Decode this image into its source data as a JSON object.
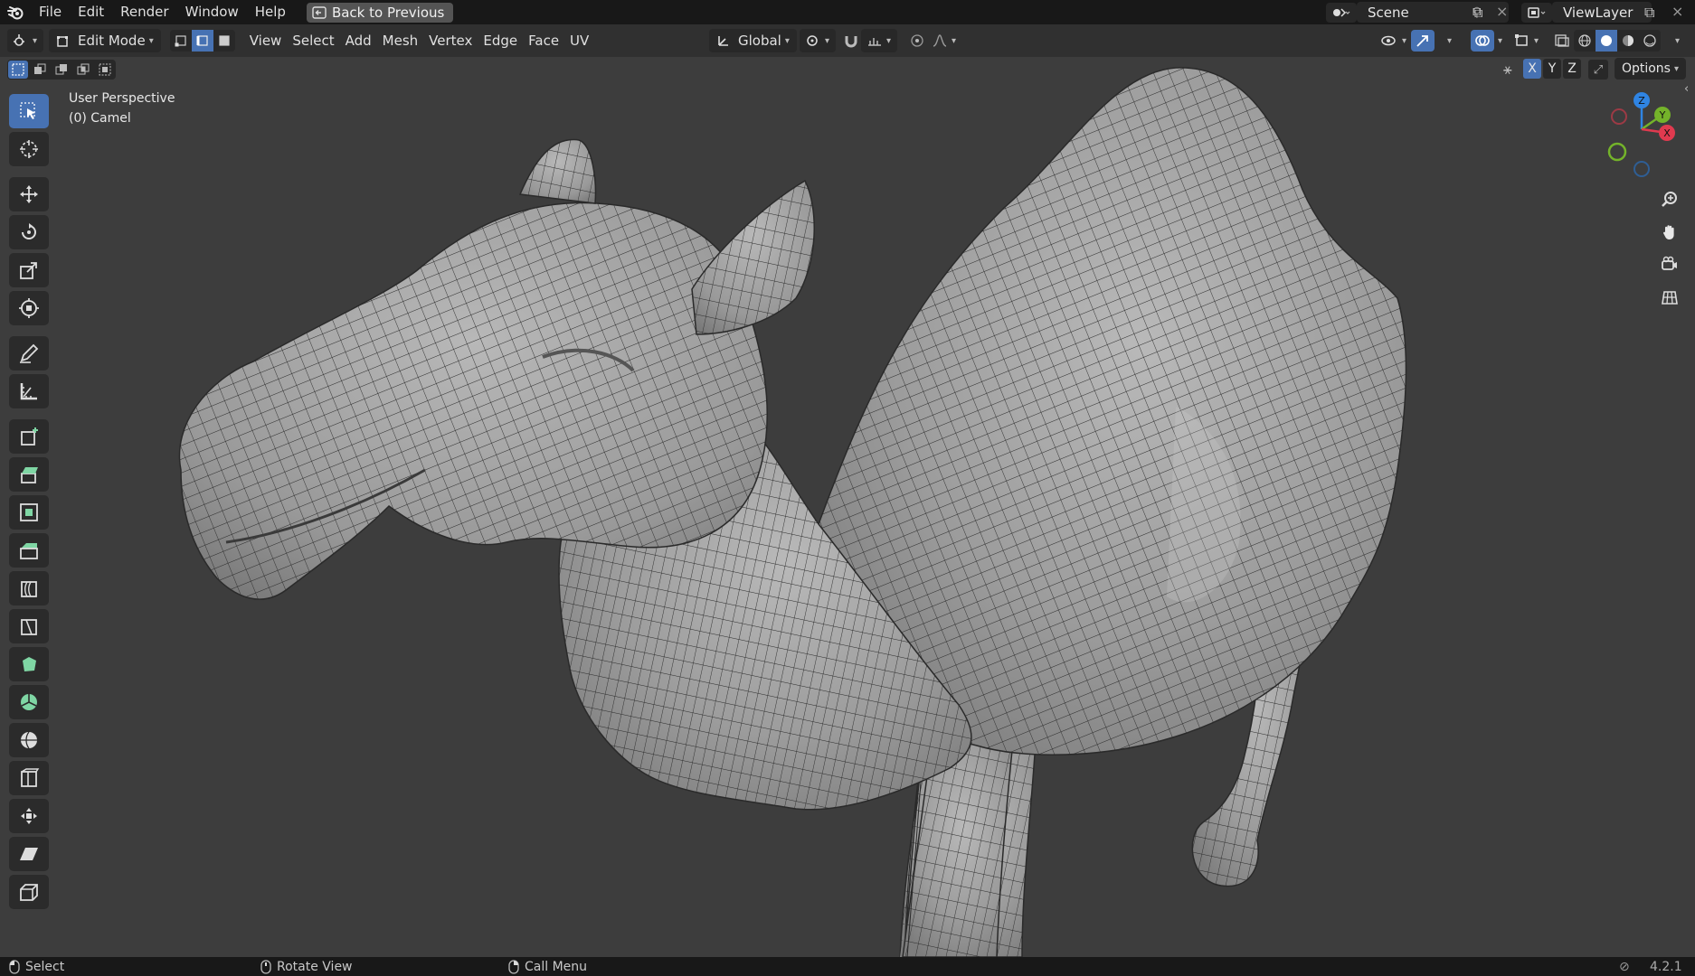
{
  "topbar": {
    "menu": [
      "File",
      "Edit",
      "Render",
      "Window",
      "Help"
    ],
    "back_button": "Back to Previous",
    "scene": "Scene",
    "view_layer": "ViewLayer"
  },
  "header": {
    "mode": "Edit Mode",
    "menus": [
      "View",
      "Select",
      "Add",
      "Mesh",
      "Vertex",
      "Edge",
      "Face",
      "UV"
    ],
    "transform_orientation": "Global",
    "select_mode_active": "edge"
  },
  "viewport": {
    "perspective_label": "User Perspective",
    "object_label": "(0) Camel",
    "axis_toggles": [
      "X",
      "Y",
      "Z"
    ],
    "axis_active": "X",
    "options_label": "Options",
    "gizmo": {
      "z": "Z",
      "y": "Y",
      "x": "X"
    }
  },
  "toolbar": {
    "tools": [
      "select-box",
      "cursor",
      "move",
      "rotate",
      "scale",
      "transform",
      "annotate",
      "measure",
      "add-cube",
      "extrude-region",
      "inset-faces",
      "bevel",
      "loop-cut",
      "knife",
      "poly-build",
      "spin",
      "smooth",
      "edge-slide",
      "shrink-fatten",
      "shear",
      "rip-region"
    ],
    "active": "select-box"
  },
  "statusbar": {
    "select": "Select",
    "rotate_view": "Rotate View",
    "call_menu": "Call Menu",
    "version": "4.2.1"
  },
  "colors": {
    "accent": "#4772b3",
    "axis_x": "#e03a4f",
    "axis_y": "#74b32a",
    "axis_z": "#2f84e3",
    "background": "#3d3d3d"
  }
}
